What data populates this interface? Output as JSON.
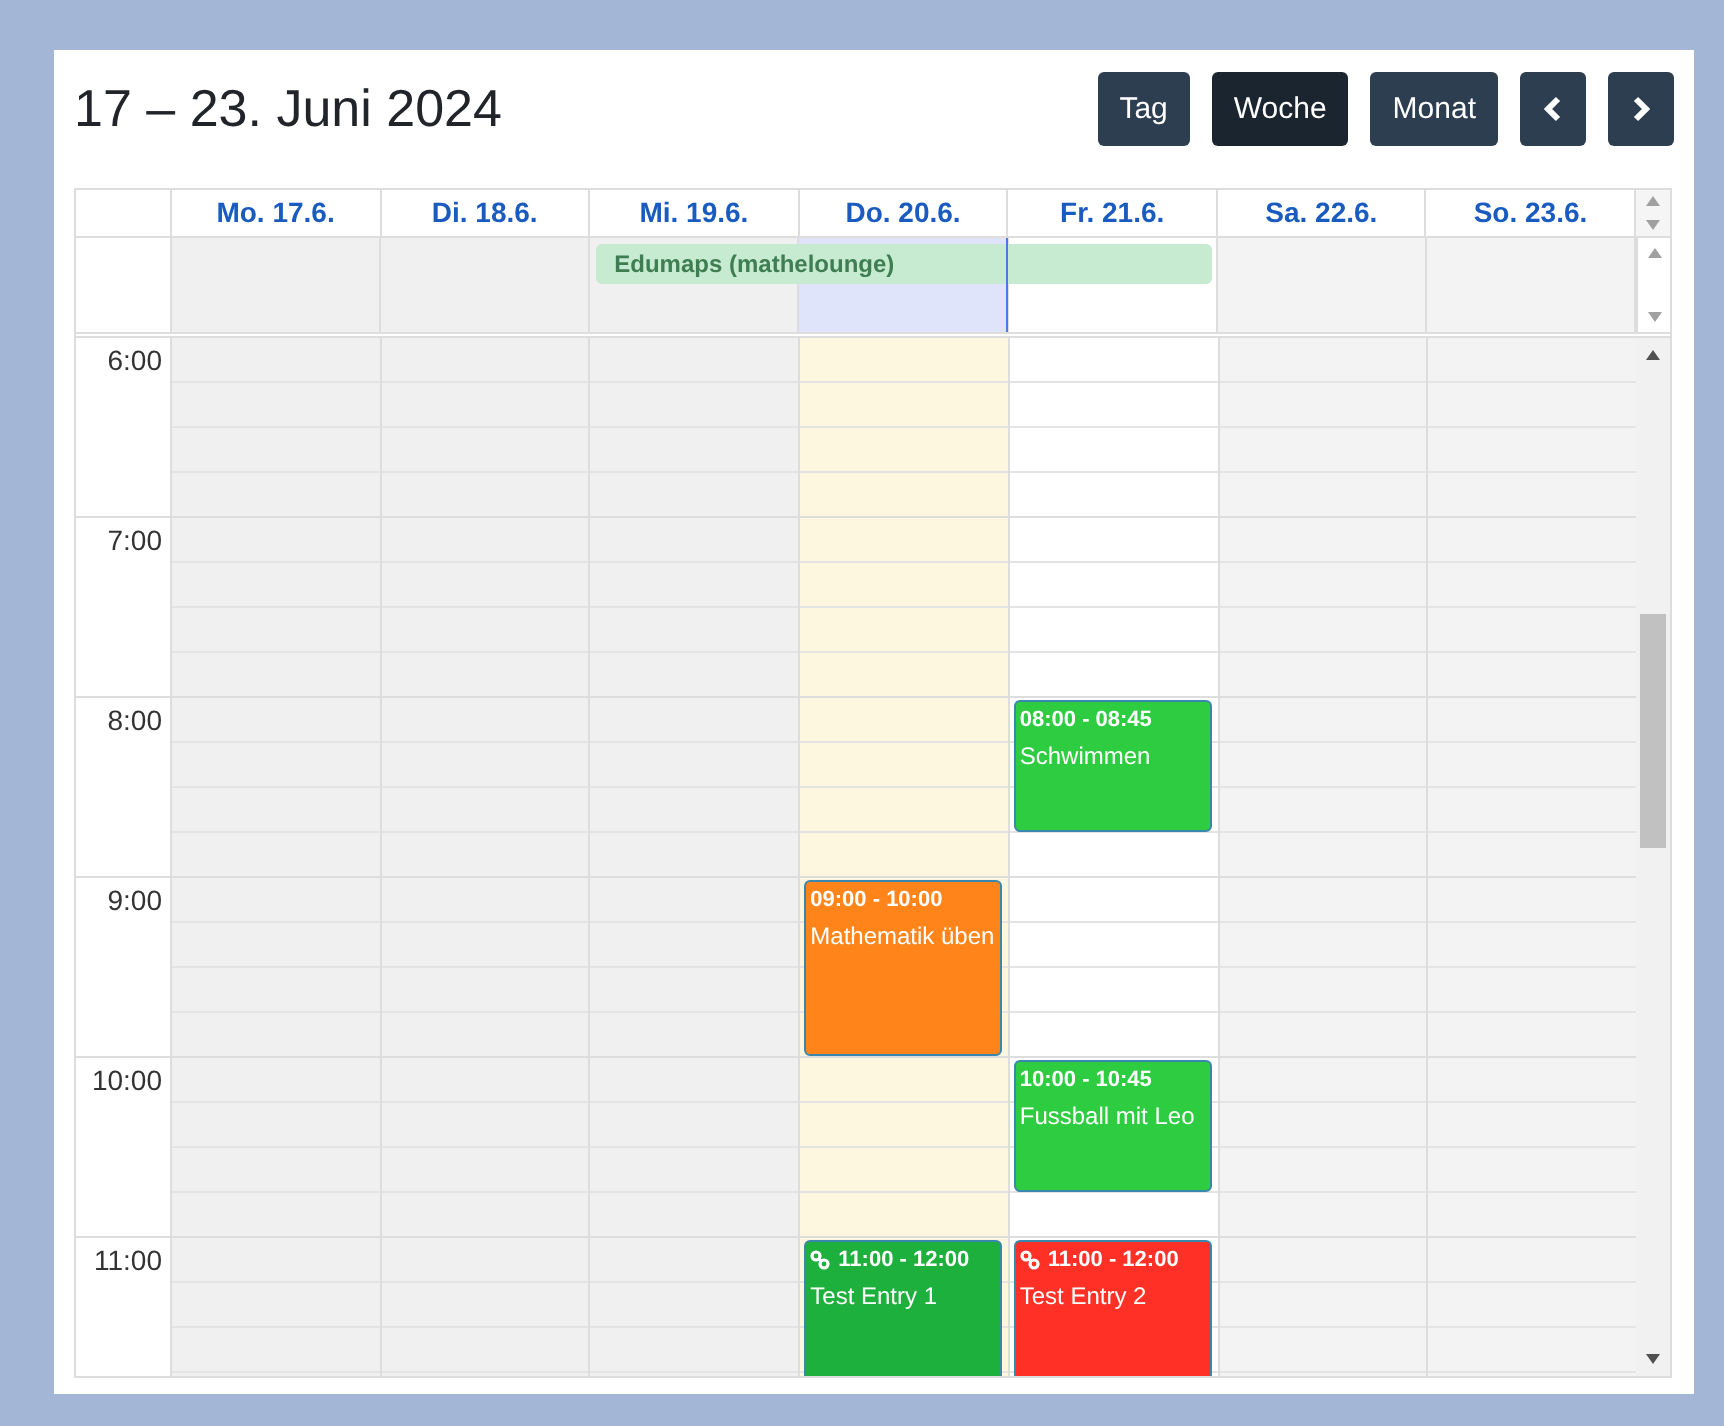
{
  "title": "17 – 23. Juni 2024",
  "view_buttons": [
    {
      "label": "Tag",
      "selected": false
    },
    {
      "label": "Woche",
      "selected": true
    },
    {
      "label": "Monat",
      "selected": false
    }
  ],
  "days": [
    {
      "label": "Mo. 17.6.",
      "kind": "past",
      "in_all_day_event": false
    },
    {
      "label": "Di. 18.6.",
      "kind": "past",
      "in_all_day_event": false
    },
    {
      "label": "Mi. 19.6.",
      "kind": "past",
      "in_all_day_event": true
    },
    {
      "label": "Do. 20.6.",
      "kind": "today",
      "in_all_day_event": true,
      "events": [
        {
          "time": "09:00 - 10:00",
          "title": "Mathematik üben",
          "color": "#ff851b",
          "linked": false
        },
        {
          "time": "11:00 - 12:00",
          "title": "Test Entry 1",
          "color": "#1eb03c",
          "linked": true
        }
      ]
    },
    {
      "label": "Fr. 21.6.",
      "kind": "future",
      "in_all_day_event": true,
      "events": [
        {
          "time": "08:00 - 08:45",
          "title": "Schwimmen",
          "color": "#2ecc40",
          "linked": false
        },
        {
          "time": "10:00 - 10:45",
          "title": "Fussball mit Leo",
          "color": "#2ecc40",
          "linked": false
        },
        {
          "time": "11:00 - 12:00",
          "title": "Test Entry 2",
          "color": "#ff3127",
          "linked": true
        }
      ]
    },
    {
      "label": "Sa. 22.6.",
      "kind": "weekend",
      "in_all_day_event": false
    },
    {
      "label": "So. 23.6.",
      "kind": "weekend",
      "in_all_day_event": false
    }
  ],
  "all_day_event": {
    "title": "Edumaps (mathelounge)",
    "color": "#c6ebd0"
  },
  "hours": [
    "6:00",
    "7:00",
    "8:00",
    "9:00",
    "10:00",
    "11:00"
  ]
}
